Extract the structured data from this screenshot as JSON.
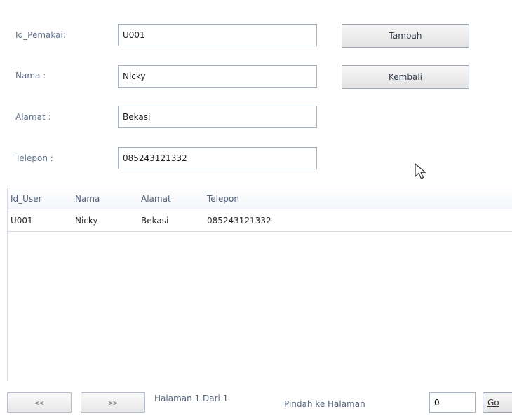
{
  "form": {
    "id_label": "Id_Pemakai:",
    "id_value": "U001",
    "nama_label": "Nama :",
    "nama_value": "Nicky",
    "alamat_label": "Alamat :",
    "alamat_value": "Bekasi",
    "telepon_label": "Telepon :",
    "telepon_value": "085243121332",
    "tambah_label": "Tambah",
    "kembali_label": "Kembali"
  },
  "grid": {
    "columns": [
      "Id_User",
      "Nama",
      "Alamat",
      "Telepon"
    ],
    "rows": [
      [
        "U001",
        "Nicky",
        "Bekasi",
        "085243121332"
      ]
    ]
  },
  "pager": {
    "prev_label": "<<",
    "next_label": ">>",
    "status": "Halaman 1 Dari 1",
    "goto_label": "Pindah ke Halaman",
    "page_value": "0",
    "go_label": "Go"
  },
  "cursor_icon": "arrow-pointer-icon"
}
